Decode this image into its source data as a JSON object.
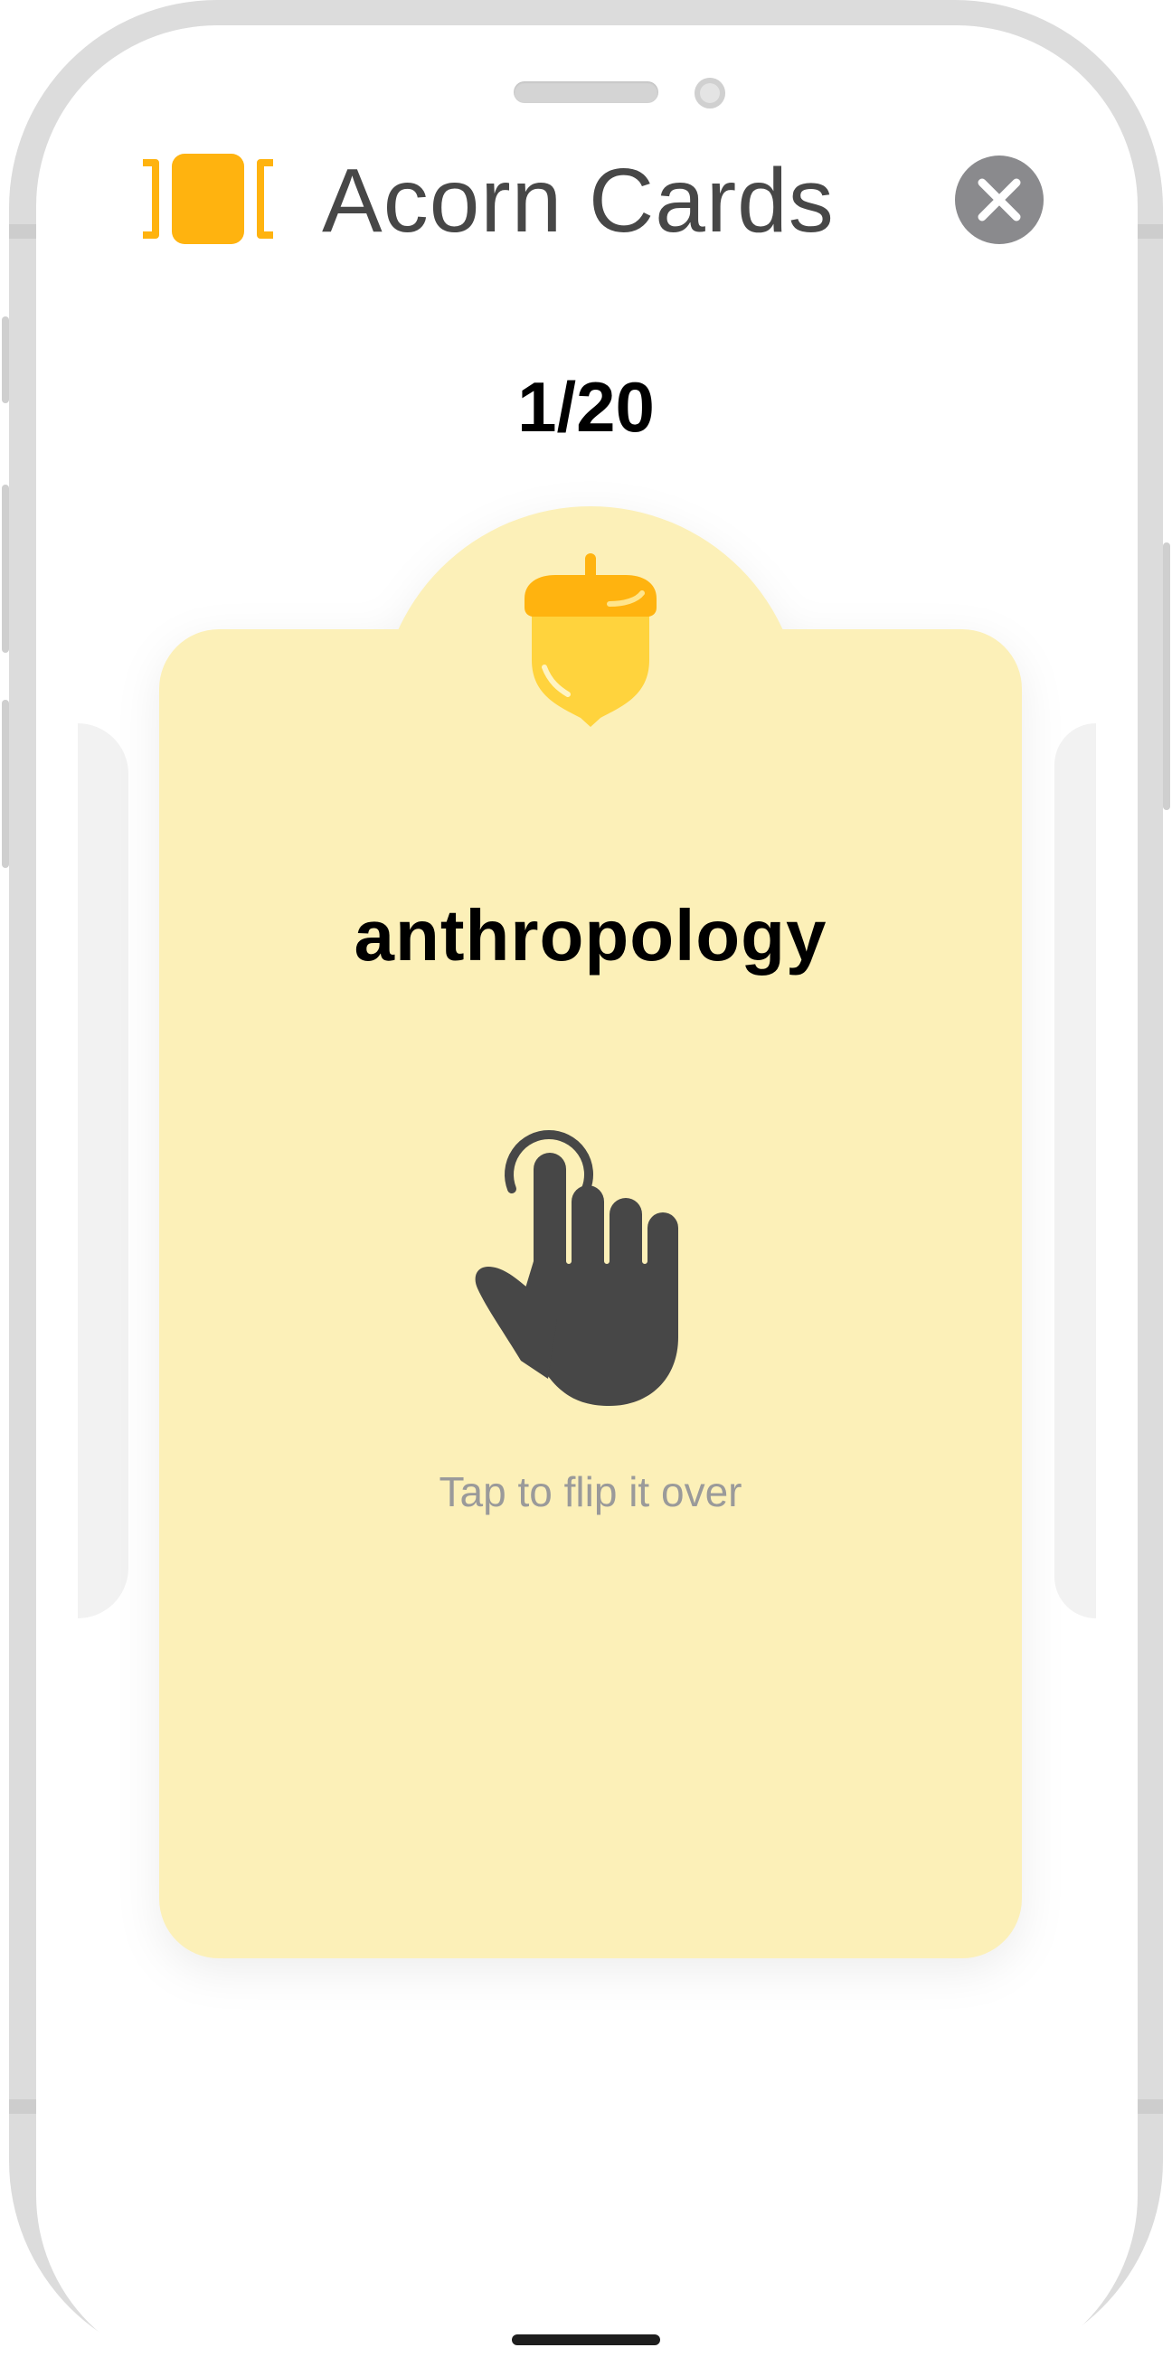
{
  "header": {
    "app_title": "Acorn Cards",
    "logo_icon": "flashcards-logo-icon",
    "close_icon": "close-icon",
    "accent_color": "#ffb30f"
  },
  "progress": {
    "counter": "1/20",
    "current": 1,
    "total": 20
  },
  "card": {
    "badge_icon": "acorn-icon",
    "term": "anthropology",
    "gesture_icon": "tap-finger-icon",
    "hint": "Tap to flip it over",
    "background_color": "#fcf0b8"
  }
}
